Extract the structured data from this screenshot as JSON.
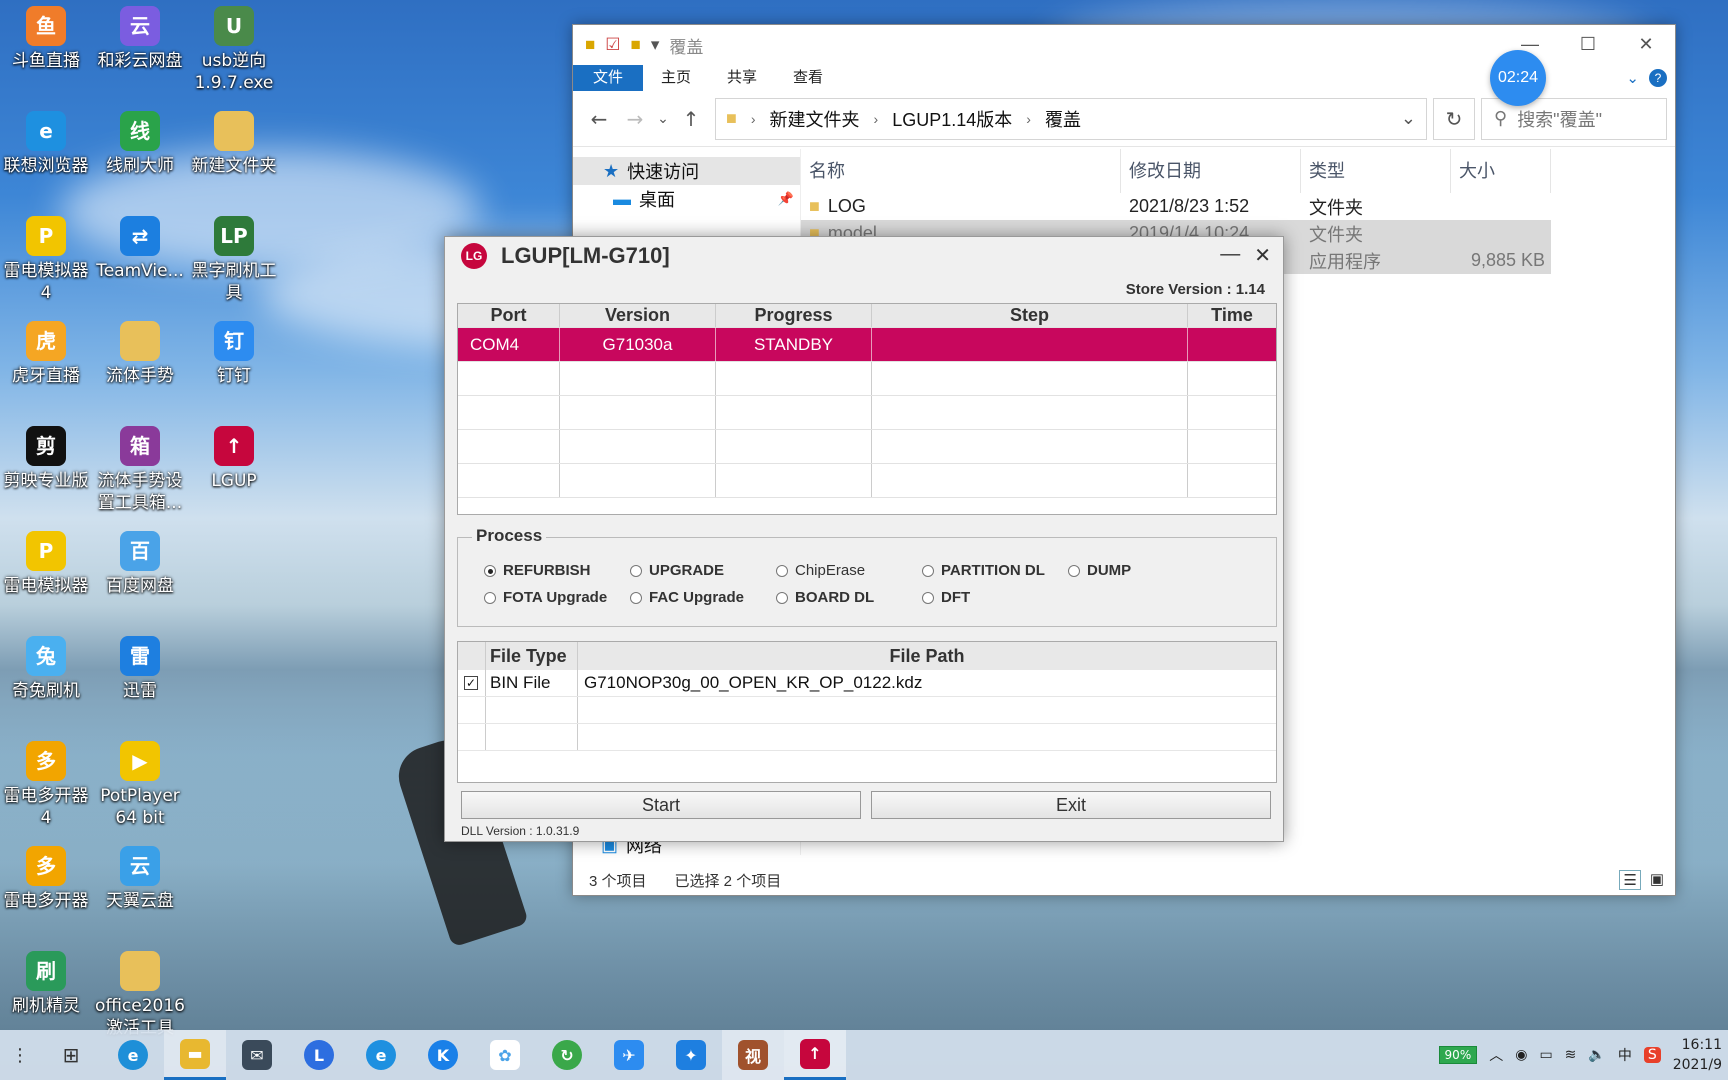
{
  "desktop": {
    "icons": [
      {
        "label": "斗鱼直播",
        "color": "#f07c2a",
        "glyph": "鱼"
      },
      {
        "label": "和彩云网盘",
        "color": "#7b5de0",
        "glyph": "云"
      },
      {
        "label": "usb逆向\n1.9.7.exe",
        "color": "#4a8a4a",
        "glyph": "U"
      },
      {
        "label": "联想浏览器",
        "color": "#1e90e0",
        "glyph": "e"
      },
      {
        "label": "线刷大师",
        "color": "#2aa34a",
        "glyph": "线"
      },
      {
        "label": "新建文件夹",
        "color": "#e8c05a",
        "glyph": ""
      },
      {
        "label": "雷电模拟器\n4",
        "color": "#f2c500",
        "glyph": "P"
      },
      {
        "label": "TeamVie...",
        "color": "#1c7fe0",
        "glyph": "⇄"
      },
      {
        "label": "黑字刷机工\n具",
        "color": "#2e7a3a",
        "glyph": "LP"
      },
      {
        "label": "虎牙直播",
        "color": "#f5a623",
        "glyph": "虎"
      },
      {
        "label": "流体手势",
        "color": "#e8c05a",
        "glyph": ""
      },
      {
        "label": "钉钉",
        "color": "#2d8cf0",
        "glyph": "钉"
      },
      {
        "label": "剪映专业版",
        "color": "#111111",
        "glyph": "剪"
      },
      {
        "label": "流体手势设\n置工具箱...",
        "color": "#8a3a9a",
        "glyph": "箱"
      },
      {
        "label": "LGUP",
        "color": "#c6063d",
        "glyph": "↑"
      },
      {
        "label": "雷电模拟器",
        "color": "#f2c500",
        "glyph": "P"
      },
      {
        "label": "百度网盘",
        "color": "#4aa3e8",
        "glyph": "百"
      },
      {
        "label": "奇兔刷机",
        "color": "#4ab0f0",
        "glyph": "兔"
      },
      {
        "label": "迅雷",
        "color": "#1e7fe0",
        "glyph": "雷"
      },
      {
        "label": "雷电多开器\n4",
        "color": "#f2a500",
        "glyph": "多"
      },
      {
        "label": "PotPlayer\n64 bit",
        "color": "#f2c500",
        "glyph": "▶"
      },
      {
        "label": "雷电多开器",
        "color": "#f2a500",
        "glyph": "多"
      },
      {
        "label": "天翼云盘",
        "color": "#3aa0e8",
        "glyph": "云"
      },
      {
        "label": "刷机精灵",
        "color": "#2a9a5a",
        "glyph": "刷"
      },
      {
        "label": "office2016\n激活工具",
        "color": "#e8c05a",
        "glyph": ""
      }
    ]
  },
  "explorer": {
    "title": "覆盖",
    "ribbon": {
      "file": "文件",
      "home": "主页",
      "share": "共享",
      "view": "查看"
    },
    "breadcrumb": [
      "新建文件夹",
      "LGUP1.14版本",
      "覆盖"
    ],
    "search_placeholder": "搜索\"覆盖\"",
    "nav": {
      "quick_access": "快速访问",
      "desktop": "桌面",
      "network": "网络"
    },
    "columns": {
      "name": "名称",
      "date": "修改日期",
      "type": "类型",
      "size": "大小"
    },
    "rows": [
      {
        "name": "LOG",
        "date": "2021/8/23 1:52",
        "type": "文件夹",
        "size": ""
      },
      {
        "name": "model",
        "date": "2019/1/4 10:24",
        "type": "文件夹",
        "size": ""
      },
      {
        "name": "",
        "date": "",
        "type": "应用程序",
        "size": "9,885 KB"
      }
    ],
    "status": {
      "count": "3 个项目",
      "selected": "已选择 2 个项目"
    }
  },
  "timer": "02:24",
  "lgup": {
    "title": "LGUP[LM-G710]",
    "logo": "LG",
    "store_version": "Store Version : 1.14",
    "port_columns": {
      "port": "Port",
      "version": "Version",
      "progress": "Progress",
      "step": "Step",
      "time": "Time"
    },
    "port_row": {
      "port": "COM4",
      "version": "G71030a",
      "progress": "STANDBY",
      "step": "",
      "time": ""
    },
    "process_label": "Process",
    "radios": [
      {
        "label": "REFURBISH",
        "checked": true
      },
      {
        "label": "UPGRADE",
        "checked": false
      },
      {
        "label": "ChipErase",
        "checked": false
      },
      {
        "label": "PARTITION DL",
        "checked": false
      },
      {
        "label": "DUMP",
        "checked": false
      },
      {
        "label": "FOTA Upgrade",
        "checked": false
      },
      {
        "label": "FAC Upgrade",
        "checked": false
      },
      {
        "label": "BOARD DL",
        "checked": false
      },
      {
        "label": "DFT",
        "checked": false
      }
    ],
    "file_columns": {
      "type": "File Type",
      "path": "File Path"
    },
    "file_row": {
      "type": "BIN File",
      "path": "G710NOP30g_00_OPEN_KR_OP_0122.kdz",
      "checked": true
    },
    "start": "Start",
    "exit": "Exit",
    "dll_version": "DLL Version : 1.0.31.9"
  },
  "taskbar": {
    "battery": "90%",
    "ime": "中",
    "time": "16:11",
    "date": "2021/9"
  }
}
